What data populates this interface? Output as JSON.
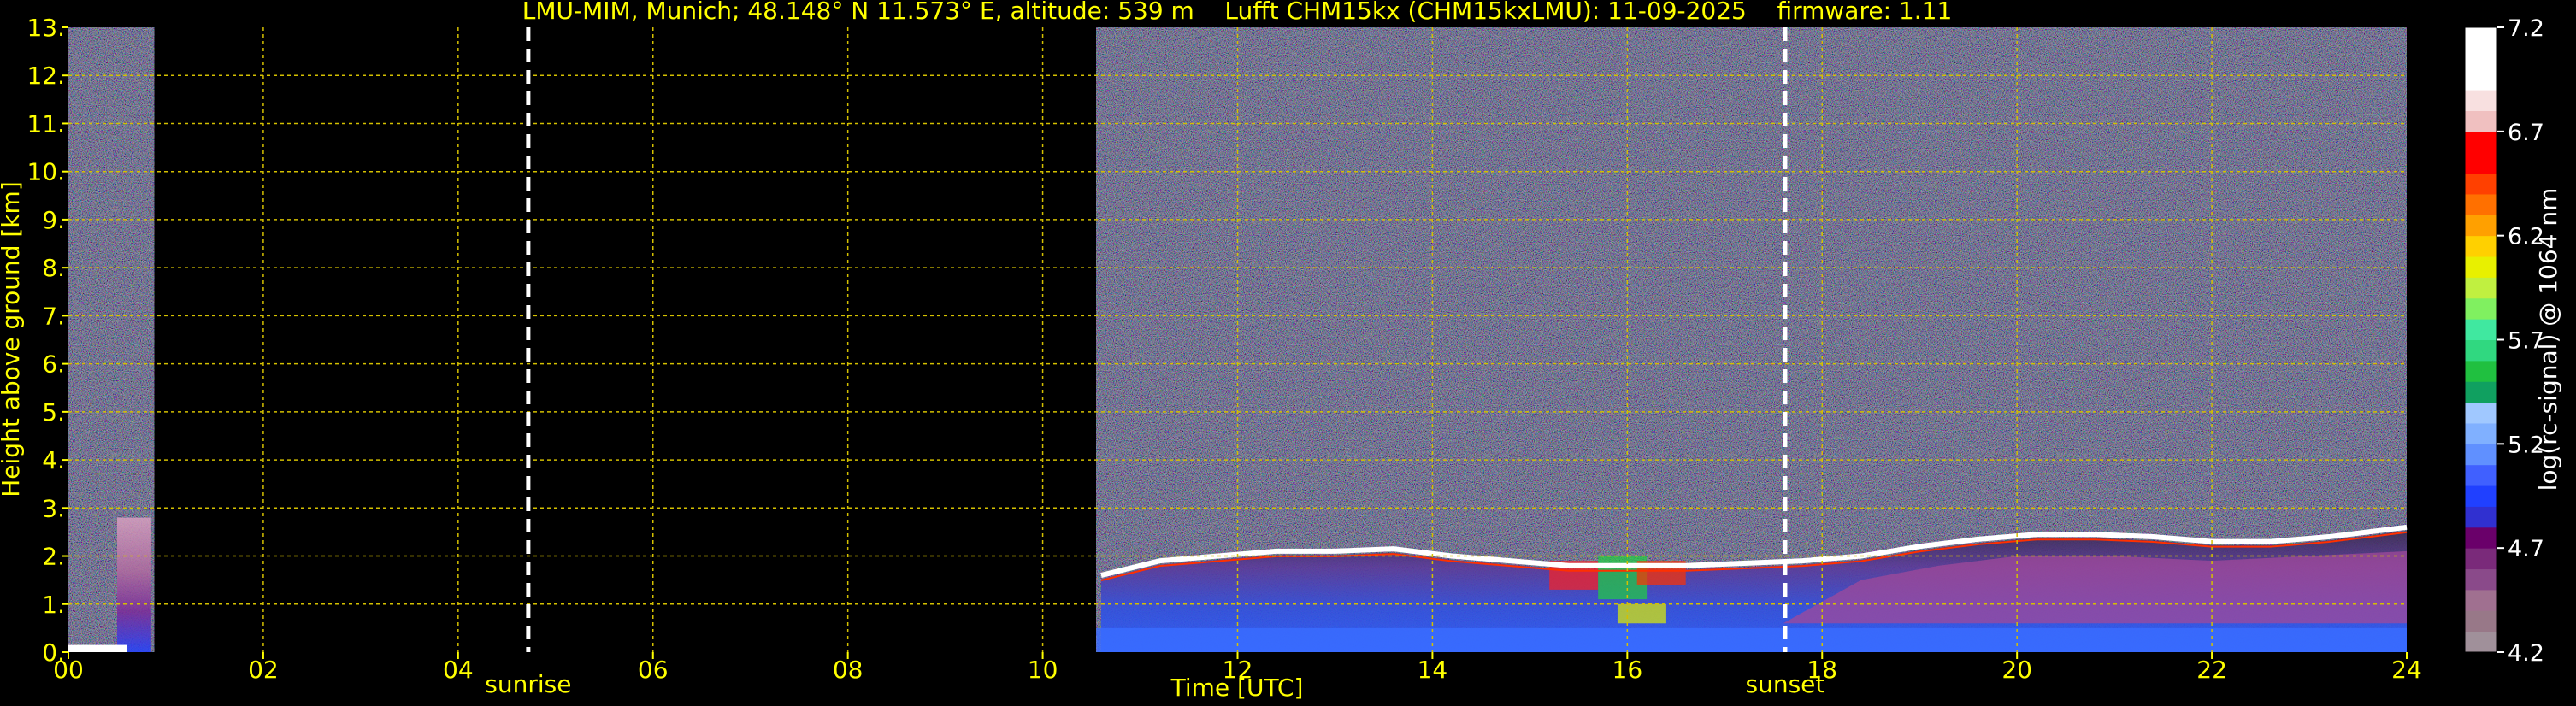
{
  "chart_data": {
    "type": "heatmap",
    "title": "LMU-MIM, Munich; 48.148° N 11.573° E, altitude: 539 m    Lufft CHM15kx (CHM15kxLMU): 11-09-2025    firmware: 1.11",
    "xlabel": "Time [UTC]",
    "ylabel": "Height above ground [km]",
    "xlim": [
      0,
      24
    ],
    "ylim": [
      0,
      13
    ],
    "x_ticks": [
      "00",
      "02",
      "04",
      "06",
      "08",
      "10",
      "12",
      "14",
      "16",
      "18",
      "20",
      "22",
      "24"
    ],
    "y_ticks": [
      "0.",
      "1.",
      "2.",
      "3.",
      "4.",
      "5.",
      "6.",
      "7.",
      "8.",
      "9.",
      "10.",
      "11.",
      "12.",
      "13."
    ],
    "grid": true,
    "colorbar": {
      "label": "log(rc-signal) @ 1064 nm",
      "range": [
        4.2,
        7.2
      ],
      "ticks": [
        "4.2",
        "4.7",
        "5.2",
        "5.7",
        "6.2",
        "6.7",
        "7.2"
      ],
      "colors": [
        "#a0909a",
        "#987888",
        "#a07090",
        "#8a4a8a",
        "#7a2a7a",
        "#6a006a",
        "#3030d0",
        "#2040ff",
        "#4060ff",
        "#6090ff",
        "#80b0ff",
        "#a0c8ff",
        "#10a060",
        "#20c040",
        "#30d880",
        "#40e8a0",
        "#80f060",
        "#c0f040",
        "#e8f000",
        "#ffd000",
        "#ffa000",
        "#ff7000",
        "#ff4000",
        "#ff0000",
        "#ff0000",
        "#f0c0c0",
        "#f8e0e0",
        "#ffffff",
        "#ffffff",
        "#ffffff"
      ]
    },
    "markers": [
      {
        "label": "sunrise",
        "x": 4.72
      },
      {
        "label": "sunset",
        "x": 17.62
      }
    ],
    "data_gaps": [
      [
        0.88,
        10.55
      ]
    ],
    "cloud_layer": {
      "times": [
        10.6,
        11.2,
        11.8,
        12.4,
        13.0,
        13.6,
        14.2,
        14.8,
        15.4,
        16.0,
        16.6,
        17.2,
        17.8,
        18.4,
        19.0,
        19.6,
        20.2,
        20.8,
        21.4,
        22.0,
        22.6,
        23.2,
        23.8,
        24.0
      ],
      "heights_km": [
        1.6,
        1.9,
        2.0,
        2.1,
        2.1,
        2.15,
        2.0,
        1.9,
        1.8,
        1.8,
        1.8,
        1.85,
        1.9,
        2.0,
        2.2,
        2.35,
        2.45,
        2.45,
        2.4,
        2.3,
        2.3,
        2.4,
        2.55,
        2.6
      ]
    }
  }
}
